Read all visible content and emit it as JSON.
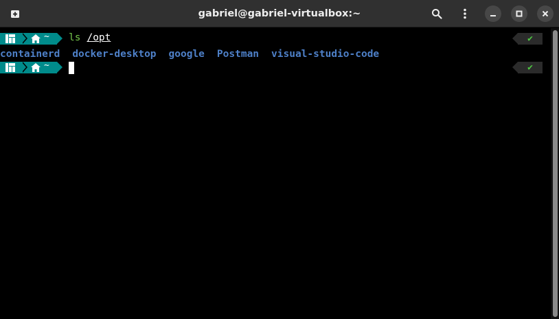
{
  "window": {
    "title": "gabriel@gabriel-virtualbox:~"
  },
  "titlebar": {
    "new_tab_icon": "new-tab-icon",
    "search_icon": "search-icon",
    "menu_icon": "kebab-menu-icon",
    "minimize_icon": "minimize-icon",
    "maximize_icon": "maximize-icon",
    "close_icon": "close-icon"
  },
  "prompt": {
    "path": "~",
    "status": "✔",
    "accent": "#008b8b"
  },
  "history": [
    {
      "command": "ls",
      "argument": "/opt",
      "output": [
        "containerd",
        "docker-desktop",
        "google",
        "Postman",
        "visual-studio-code"
      ]
    }
  ],
  "colors": {
    "dir_listing": "#4e80c8",
    "command": "#76c64b",
    "check": "#4ec942"
  }
}
